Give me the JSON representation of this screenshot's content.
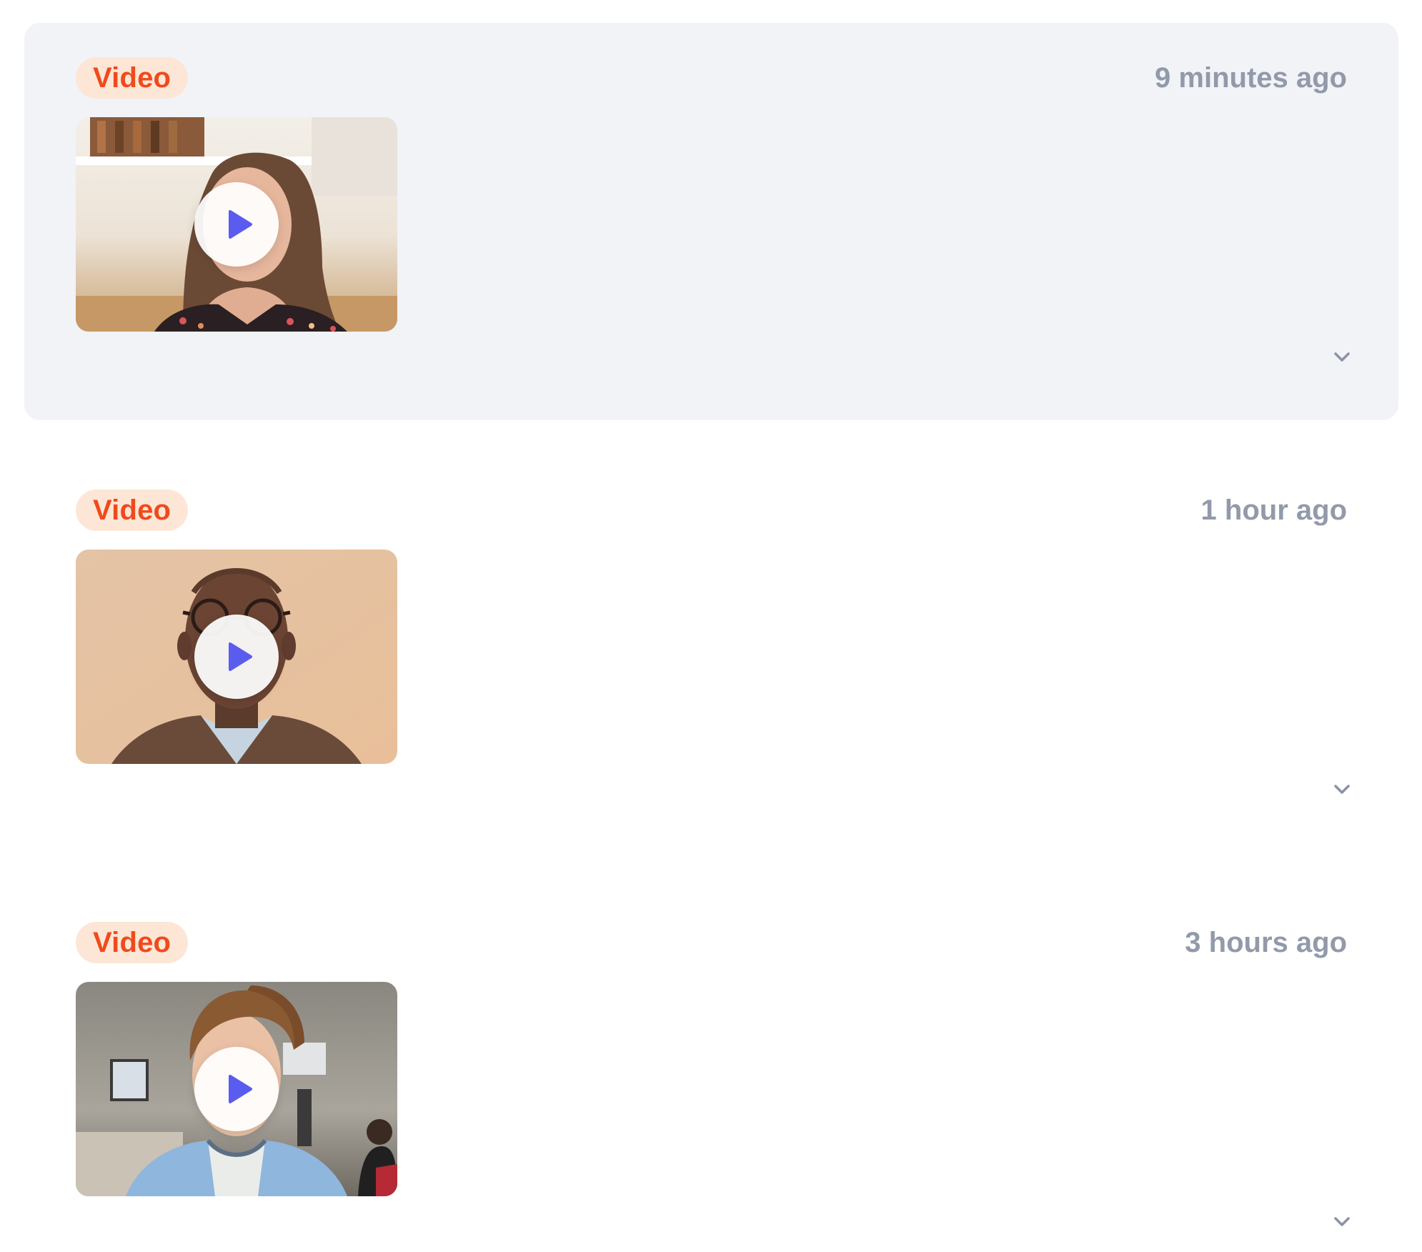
{
  "feed": {
    "items": [
      {
        "badge": "Video",
        "timestamp": "9 minutes ago",
        "highlighted": true,
        "thumbnail": {
          "subject": "smiling woman with long brown hair in floral top, kitchen background"
        }
      },
      {
        "badge": "Video",
        "timestamp": "1 hour ago",
        "highlighted": false,
        "thumbnail": {
          "subject": "bald man with glasses in brown blazer, beige wall background"
        }
      },
      {
        "badge": "Video",
        "timestamp": "3 hours ago",
        "highlighted": false,
        "thumbnail": {
          "subject": "man with styled hair in light blue denim shirt, office background"
        }
      }
    ]
  },
  "colors": {
    "badge_bg": "#fde6d6",
    "badge_text": "#f04a1c",
    "timestamp_text": "#929aaa",
    "highlight_bg": "#f1f3f7",
    "play_icon": "#5a5cf0",
    "chevron": "#8a93a3"
  },
  "icons": {
    "play": "play-icon",
    "expand": "chevron-down-icon"
  }
}
